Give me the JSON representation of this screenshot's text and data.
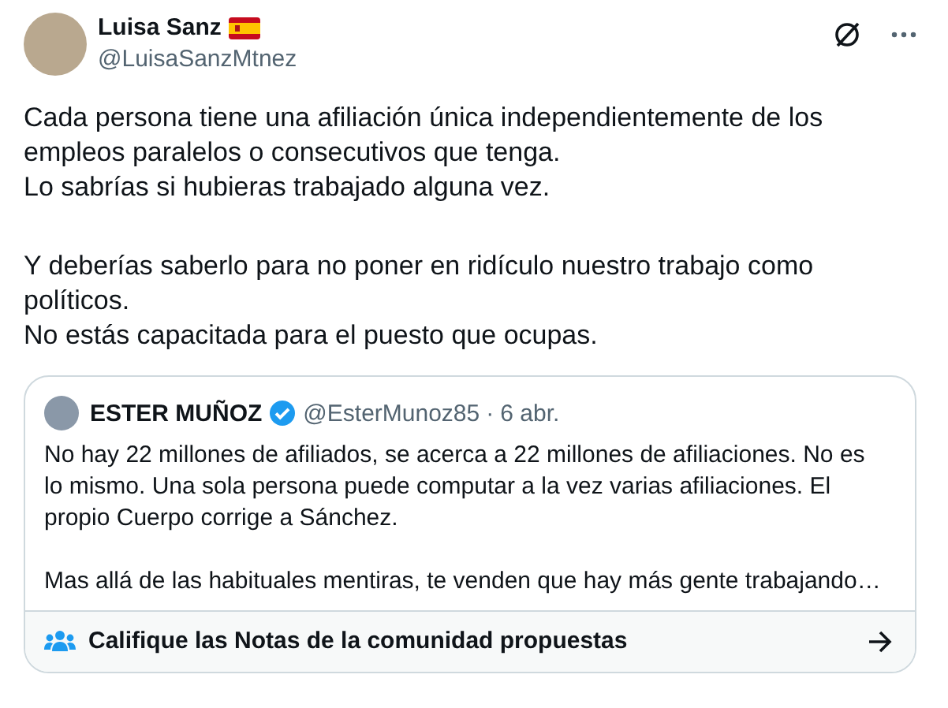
{
  "author": {
    "name": "Luisa Sanz",
    "handle": "@LuisaSanzMtnez"
  },
  "paragraphs": [
    "Cada persona tiene una afiliación única independientemente de los empleos paralelos o consecutivos que tenga.\nLo sabrías si hubieras trabajado alguna vez.",
    "Y deberías saberlo para no poner en ridículo nuestro trabajo como políticos.\nNo estás capacitada para el puesto que ocupas."
  ],
  "quote": {
    "name": "ESTER MUÑOZ",
    "verified": true,
    "handle": "@EsterMunoz85",
    "separator": "·",
    "date": "6 abr.",
    "paragraphs": [
      "No hay 22 millones de afiliados, se acerca a 22 millones de afiliaciones. No es lo mismo. Una sola persona puede computar a la vez varias afiliaciones. El propio Cuerpo corrige a Sánchez.",
      "Mas allá de las habituales mentiras, te venden que hay más gente trabajando…"
    ]
  },
  "community_notes": {
    "label": "Califique las Notas de la comunidad propuestas"
  }
}
